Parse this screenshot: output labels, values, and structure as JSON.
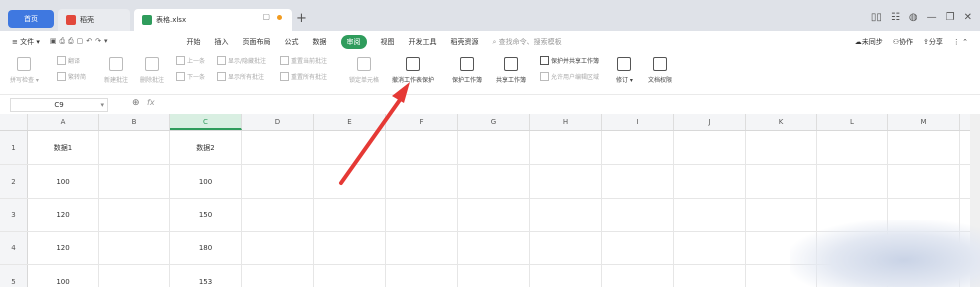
{
  "titlebar": {
    "tabs": [
      {
        "label": "首页",
        "icon": "home-icon"
      },
      {
        "label": "稻壳",
        "icon": "docer-icon"
      },
      {
        "label": "表格.xlsx",
        "icon": "spreadsheet-icon"
      }
    ],
    "add_tab": "+",
    "win_buttons": [
      "▯▯",
      "☷",
      "◍",
      "—",
      "❐",
      "✕"
    ]
  },
  "menubar": {
    "file_label": "≡ 文件 ▾",
    "items": [
      "开始",
      "插入",
      "页面布局",
      "公式",
      "数据",
      "审阅",
      "视图",
      "开发工具",
      "稻壳资源"
    ],
    "active": "审阅",
    "search_placeholder": "查找命令、搜索模板",
    "right": [
      "未同步",
      "协作",
      "分享"
    ]
  },
  "ribbon": {
    "spellcheck": "拼写检查 ▾",
    "translate": "翻译",
    "simp_trad": "繁转简",
    "new_comment": "新建批注",
    "delete_comment": "删除批注",
    "prev": "上一条",
    "next": "下一条",
    "show_hide_comment": "显示/隐藏批注",
    "show_all_comments": "显示所有批注",
    "reset_current": "重置当前批注",
    "reset_all": "重置所有批注",
    "lock_cells": "锁定单元格",
    "unprotect_sheet": "撤消工作表保护",
    "protect_workbook": "保护工作簿",
    "share_workbook": "共享工作簿",
    "protect_and_share": "保护并共享工作簿",
    "allow_edit_ranges": "允许用户编辑区域",
    "track_changes": "修订 ▾",
    "doc_permissions": "文档权限"
  },
  "formula": {
    "cell_ref": "C9",
    "fx": "fx"
  },
  "sheet": {
    "columns": [
      "A",
      "B",
      "C",
      "D",
      "E",
      "F",
      "G",
      "H",
      "I",
      "J",
      "K",
      "L",
      "M"
    ],
    "selected_column": "C",
    "rows": [
      {
        "num": "1",
        "A": "数据1",
        "C": "数据2"
      },
      {
        "num": "2",
        "A": "100",
        "C": "100"
      },
      {
        "num": "3",
        "A": "120",
        "C": "150"
      },
      {
        "num": "4",
        "A": "120",
        "C": "180"
      },
      {
        "num": "5",
        "A": "100",
        "C": "153"
      }
    ]
  },
  "colors": {
    "accent_green": "#2f9c5c",
    "arrow_red": "#e53935",
    "tab_blue": "#3f78e0"
  }
}
